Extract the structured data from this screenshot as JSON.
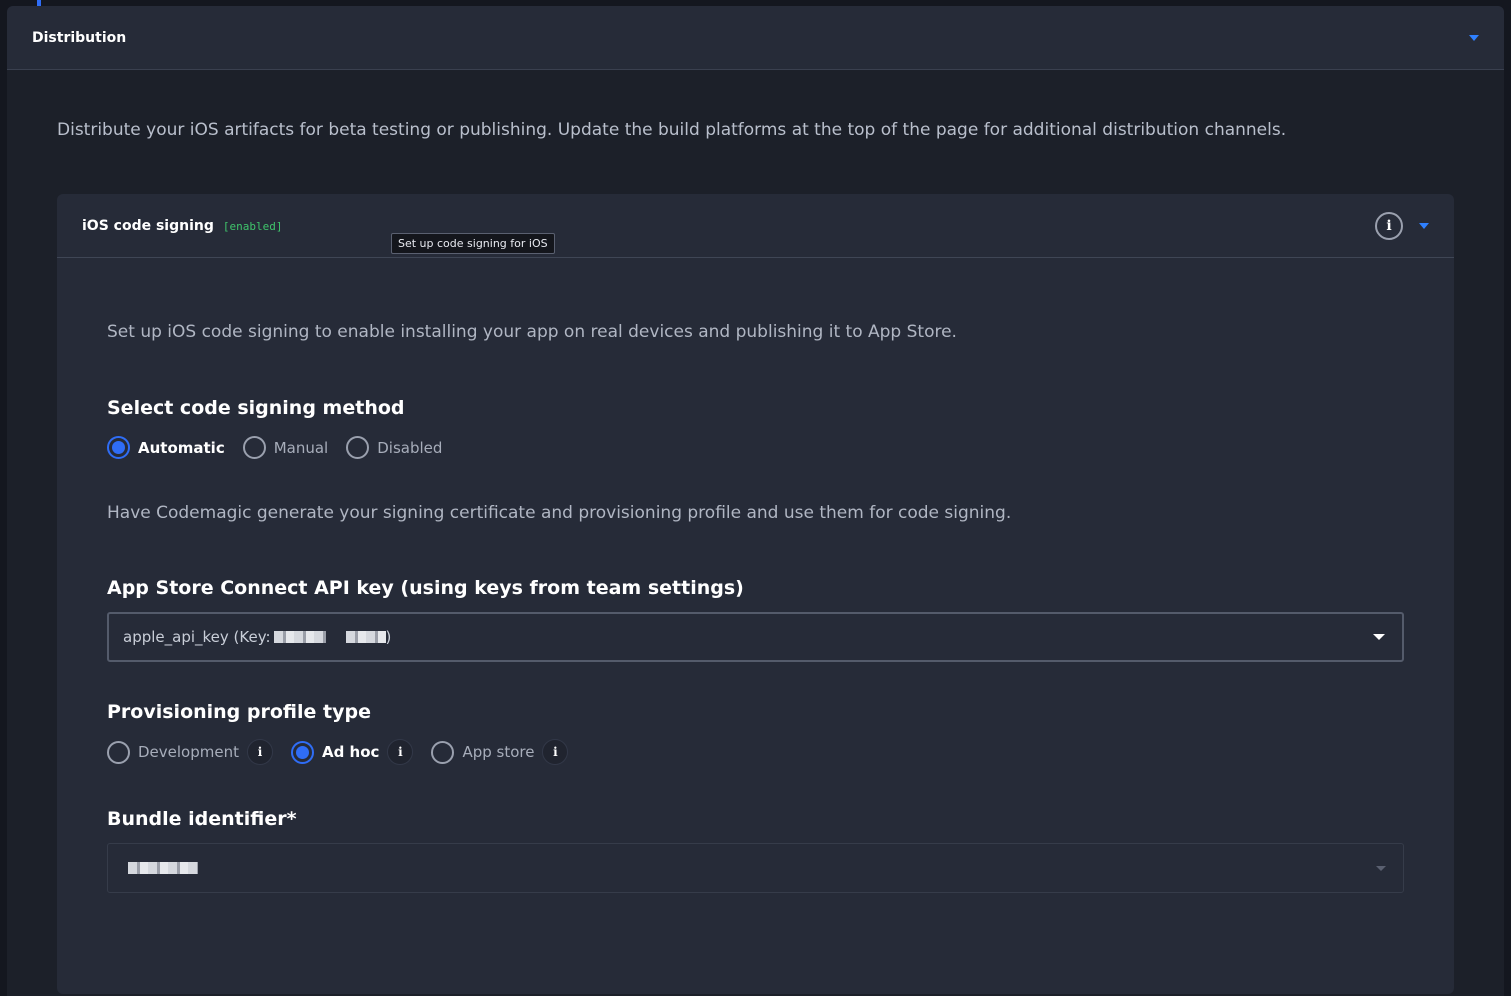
{
  "panel": {
    "title": "Distribution",
    "intro": "Distribute your iOS artifacts for beta testing or publishing. Update the build platforms at the top of the page for additional distribution channels."
  },
  "card": {
    "title": "iOS code signing",
    "badge": "[enabled]",
    "tooltip": "Set up code signing for iOS",
    "description": "Set up iOS code signing to enable installing your app on real devices and publishing it to App Store.",
    "method": {
      "heading": "Select code signing method",
      "options": [
        "Automatic",
        "Manual",
        "Disabled"
      ],
      "selected": "Automatic",
      "help": "Have Codemagic generate your signing certificate and provisioning profile and use them for code signing."
    },
    "api_key": {
      "heading": "App Store Connect API key (using keys from team settings)",
      "value_prefix": "apple_api_key (Key:",
      "value_suffix": ")"
    },
    "profile": {
      "heading": "Provisioning profile type",
      "options": [
        "Development",
        "Ad hoc",
        "App store"
      ],
      "selected": "Ad hoc",
      "info_glyph": "i"
    },
    "bundle": {
      "heading": "Bundle identifier*"
    }
  },
  "colors": {
    "accent": "#2f6df6",
    "enabled_badge": "#3fc46b",
    "caret": "#2f80ff"
  }
}
